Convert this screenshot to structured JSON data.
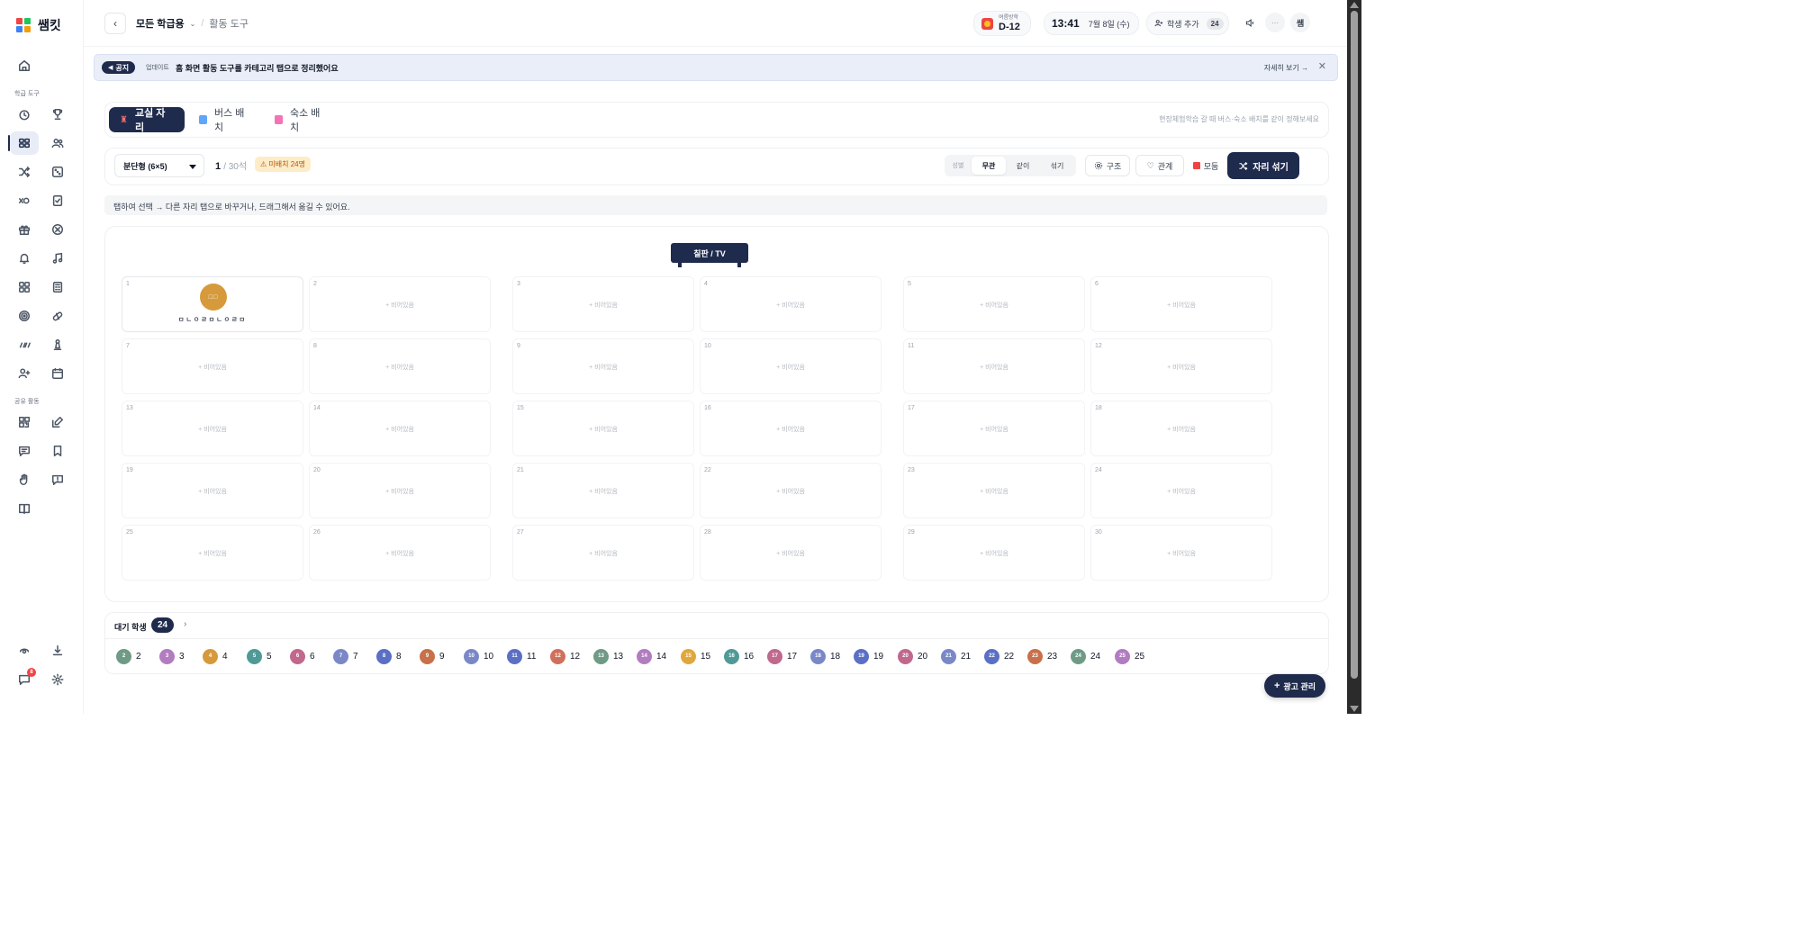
{
  "app": {
    "name": "쌤킷"
  },
  "sidebar": {
    "section_school": "학급 도구",
    "section_common": "공유 활동",
    "notification_count": "8"
  },
  "header": {
    "breadcrumb_main": "모든 학급용",
    "breadcrumb_sub": "활동 도구",
    "dday_label": "여름방학",
    "dday_value": "D-12",
    "time": "13:41",
    "date": "7월 8일 (수)",
    "add_student_label": "학생 추가",
    "student_count": "24",
    "profile_initial": "쌤"
  },
  "notice": {
    "tag": "공지",
    "update_label": "업데이트",
    "message": "홈 화면 활동 도구를 카테고리 탭으로 정리했어요",
    "more_link": "자세히 보기 →",
    "close": "✕"
  },
  "tabs": [
    {
      "label": "교실 자리"
    },
    {
      "label": "버스 배치"
    },
    {
      "label": "숙소 배치"
    }
  ],
  "tabs_hint": "현장체험학습 갈 때 버스·숙소 배치를 같이 정해보세요",
  "toolbar": {
    "layout": "분단형 (6×5)",
    "seats_filled": "1",
    "seats_total": "/ 30석",
    "unassigned": "⚠ 미배치 24명",
    "gender_label": "성별",
    "gender_options": [
      "무관",
      "같이",
      "섞기"
    ],
    "structure": "구조",
    "relation": "관계",
    "group": "모둠",
    "shuffle": "자리 섞기"
  },
  "hint": "탭하여 선택 → 다른 자리 탭으로 바꾸거나, 드래그해서 옮길 수 있어요.",
  "classroom": {
    "board": "칠판 / TV",
    "empty_label": "+ 비어있음",
    "seats": [
      {
        "num": "1",
        "student": "ㅁㄴㅇㄹㅁㄴㅇㄹㅁ"
      },
      {
        "num": "2"
      },
      {
        "num": "3"
      },
      {
        "num": "4"
      },
      {
        "num": "5"
      },
      {
        "num": "6"
      },
      {
        "num": "7"
      },
      {
        "num": "8"
      },
      {
        "num": "9"
      },
      {
        "num": "10"
      },
      {
        "num": "11"
      },
      {
        "num": "12"
      },
      {
        "num": "13"
      },
      {
        "num": "14"
      },
      {
        "num": "15"
      },
      {
        "num": "16"
      },
      {
        "num": "17"
      },
      {
        "num": "18"
      },
      {
        "num": "19"
      },
      {
        "num": "20"
      },
      {
        "num": "21"
      },
      {
        "num": "22"
      },
      {
        "num": "23"
      },
      {
        "num": "24"
      },
      {
        "num": "25"
      },
      {
        "num": "26"
      },
      {
        "num": "27"
      },
      {
        "num": "28"
      },
      {
        "num": "29"
      },
      {
        "num": "30"
      }
    ]
  },
  "waiting": {
    "title": "대기 학생",
    "count": "24",
    "students": [
      {
        "n": "2",
        "color": "#6f9a86"
      },
      {
        "n": "3",
        "color": "#b27cc0"
      },
      {
        "n": "4",
        "color": "#d69a3c"
      },
      {
        "n": "5",
        "color": "#4f9a96"
      },
      {
        "n": "6",
        "color": "#c0688d"
      },
      {
        "n": "7",
        "color": "#7a88c8"
      },
      {
        "n": "8",
        "color": "#5b6fc4"
      },
      {
        "n": "9",
        "color": "#c8704a"
      },
      {
        "n": "10",
        "color": "#7a88c8"
      },
      {
        "n": "11",
        "color": "#5b6fc4"
      },
      {
        "n": "12",
        "color": "#d0705a"
      },
      {
        "n": "13",
        "color": "#6f9a86"
      },
      {
        "n": "14",
        "color": "#b27cc0"
      },
      {
        "n": "15",
        "color": "#e0a73a"
      },
      {
        "n": "16",
        "color": "#4f9a96"
      },
      {
        "n": "17",
        "color": "#c0688d"
      },
      {
        "n": "18",
        "color": "#7a88c8"
      },
      {
        "n": "19",
        "color": "#5b6fc4"
      },
      {
        "n": "20",
        "color": "#c0688d"
      },
      {
        "n": "21",
        "color": "#7a88c8"
      },
      {
        "n": "22",
        "color": "#5b6fc4"
      },
      {
        "n": "23",
        "color": "#c8704a"
      },
      {
        "n": "24",
        "color": "#6f9a86"
      },
      {
        "n": "25",
        "color": "#b27cc0"
      }
    ]
  },
  "ad_button": "광고 관리",
  "colors": {
    "primary": "#1f2b4d",
    "warning_bg": "#fdecc8",
    "warning_text": "#b45309"
  }
}
